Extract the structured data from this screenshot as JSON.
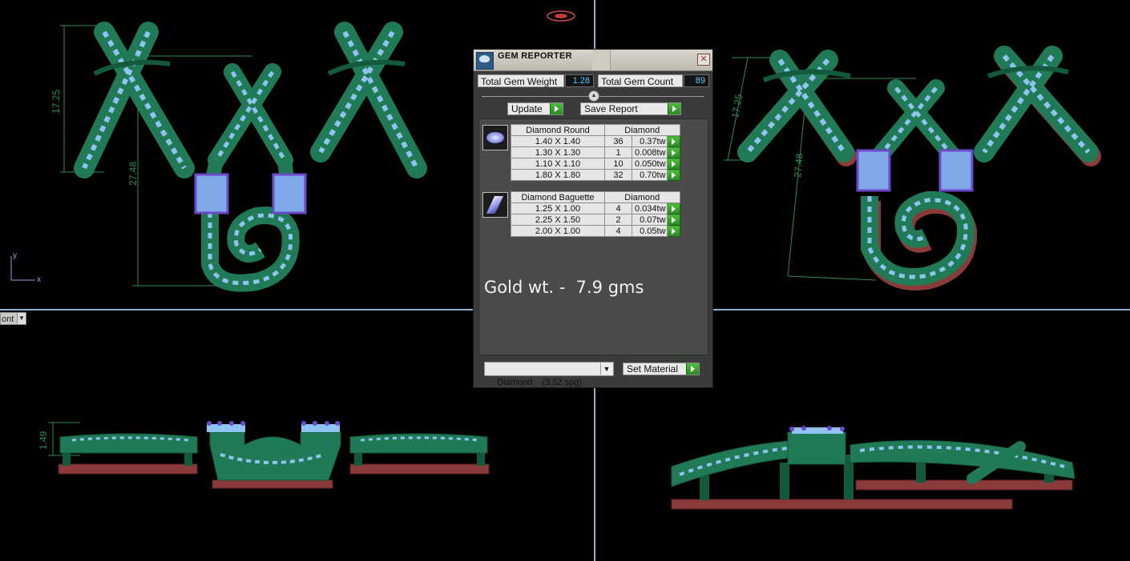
{
  "viewports": {
    "top_left": {
      "dim_a": "17.25",
      "dim_b": "27.48",
      "axis_y": "y",
      "axis_x": "x"
    },
    "top_right": {
      "dim_a": "17.25",
      "dim_b": "27.48"
    },
    "bottom_left": {
      "dim_a": "1.49",
      "view_menu": "ont"
    },
    "colors": {
      "metal": "#1f7a55",
      "metal_dark": "#135a3c",
      "gem": "#8fc4f2",
      "setting": "#6d49c9",
      "base": "#8b3a3a",
      "dim_line": "#2e8b57",
      "divider": "#8fb0cc"
    }
  },
  "dialog": {
    "title": "GEM REPORTER",
    "total_weight_label": "Total Gem Weight",
    "total_weight_value": "1.28",
    "total_count_label": "Total Gem Count",
    "total_count_value": "89",
    "update_label": "Update",
    "save_report_label": "Save Report",
    "groups": [
      {
        "icon": "round-diamond-icon",
        "header_name": "Diamond Round",
        "header_material": "Diamond",
        "rows": [
          {
            "size": "1.40 X 1.40",
            "count": "36",
            "weight": "0.37tw"
          },
          {
            "size": "1.30 X 1.30",
            "count": "1",
            "weight": "0.008tw"
          },
          {
            "size": "1.10 X 1.10",
            "count": "10",
            "weight": "0.050tw"
          },
          {
            "size": "1.80 X 1.80",
            "count": "32",
            "weight": "0.70tw"
          }
        ]
      },
      {
        "icon": "baguette-diamond-icon",
        "header_name": "Diamond Baguette",
        "header_material": "Diamond",
        "rows": [
          {
            "size": "1.25 X 1.00",
            "count": "4",
            "weight": "0.034tw"
          },
          {
            "size": "2.25 X 1.50",
            "count": "2",
            "weight": "0.07tw"
          },
          {
            "size": "2.00 X 1.00",
            "count": "4",
            "weight": "0.05tw"
          }
        ]
      }
    ],
    "gold_weight": "Gold wt. -  7.9 gms",
    "material_select": "Diamond    (3.52 spg)",
    "set_material_label": "Set Material"
  }
}
